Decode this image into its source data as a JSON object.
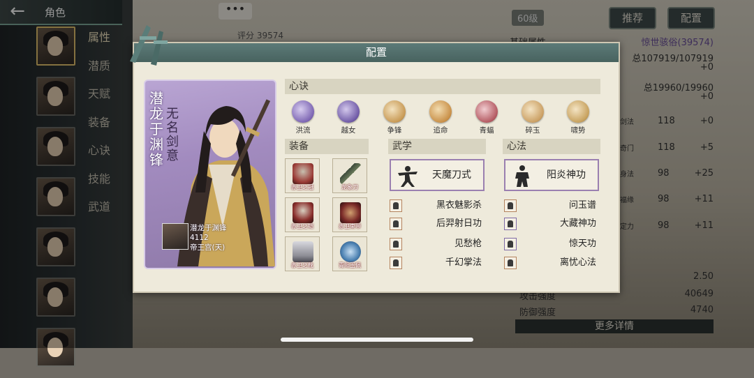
{
  "nav": {
    "back_icon": "arrow-left-icon",
    "title": "角色"
  },
  "side_menu": [
    "属性",
    "潜质",
    "天赋",
    "装备",
    "心诀",
    "技能",
    "武道"
  ],
  "background": {
    "chat_label": "•••",
    "score": "评分 39574",
    "level": "60级",
    "btn_recommend": "推荐",
    "btn_config": "配置",
    "stats": {
      "basic_title": "基础属性",
      "basic_value": "惊世骇俗(39574)",
      "hp_label": "总107919/107919",
      "hp_plus": "+0",
      "mp_label": "总19960/19960",
      "mp_plus": "+0",
      "rows": [
        {
          "name": "剑法",
          "val": "118",
          "plus": "+0"
        },
        {
          "name": "奇门",
          "val": "118",
          "plus": "+5"
        },
        {
          "name": "身法",
          "val": "98",
          "plus": "+25"
        },
        {
          "name": "福缘",
          "val": "98",
          "plus": "+11"
        },
        {
          "name": "定力",
          "val": "98",
          "plus": "+11"
        }
      ],
      "crit": "2.50",
      "attack_label": "攻击强度",
      "attack": "40649",
      "defense_label": "防御强度",
      "defense": "4740"
    },
    "more_details": "更多详情"
  },
  "dialog": {
    "title": "配置",
    "card": {
      "title_vertical": "潜龙于渊锋",
      "subtitle_vertical": "无名剑意",
      "owner_name": "潜龙于渊锋",
      "owner_score": "4112",
      "owner_server": "帝王宫(天)"
    },
    "xinjue": {
      "label": "心诀",
      "items": [
        {
          "name": "洪流",
          "icon": "purple-swirl-icon",
          "color": "#7d66b3"
        },
        {
          "name": "越女",
          "icon": "purple-swirl-icon",
          "color": "#6f5aa6"
        },
        {
          "name": "争锋",
          "icon": "gold-strike-icon",
          "color": "#c89a55"
        },
        {
          "name": "追命",
          "icon": "gold-strike-icon",
          "color": "#c99048"
        },
        {
          "name": "青蝠",
          "icon": "red-swirl-icon",
          "color": "#b45a62"
        },
        {
          "name": "碎玉",
          "icon": "gold-strike-icon",
          "color": "#cba064"
        },
        {
          "name": "啸势",
          "icon": "gold-strike-icon",
          "color": "#c7a15d"
        }
      ]
    },
    "equipment": {
      "label": "装备",
      "items": [
        {
          "name": "赤卫之冠",
          "icon": "helmet-icon",
          "color": "#9a3a35"
        },
        {
          "name": "龙象刀",
          "icon": "blade-icon",
          "color": "#3c4a3a"
        },
        {
          "name": "赤卫之铠",
          "icon": "armor-icon",
          "color": "#8a2f2c"
        },
        {
          "name": "赤卫束带",
          "icon": "belt-icon",
          "color": "#7a2a28"
        },
        {
          "name": "赤卫之靴",
          "icon": "boots-icon",
          "color": "#8c8c94"
        },
        {
          "name": "青阳玉佩",
          "icon": "pendant-icon",
          "color": "#4a7fb0"
        }
      ]
    },
    "wuxue": {
      "label": "武学",
      "main": "天魔刀式",
      "items": [
        "黑衣魅影杀",
        "后羿射日功",
        "见愁枪",
        "千幻掌法"
      ]
    },
    "xinfa": {
      "label": "心法",
      "main": "阳炎神功",
      "items": [
        "问玉谱",
        "大藏神功",
        "惊天功",
        "离忧心法"
      ]
    }
  }
}
